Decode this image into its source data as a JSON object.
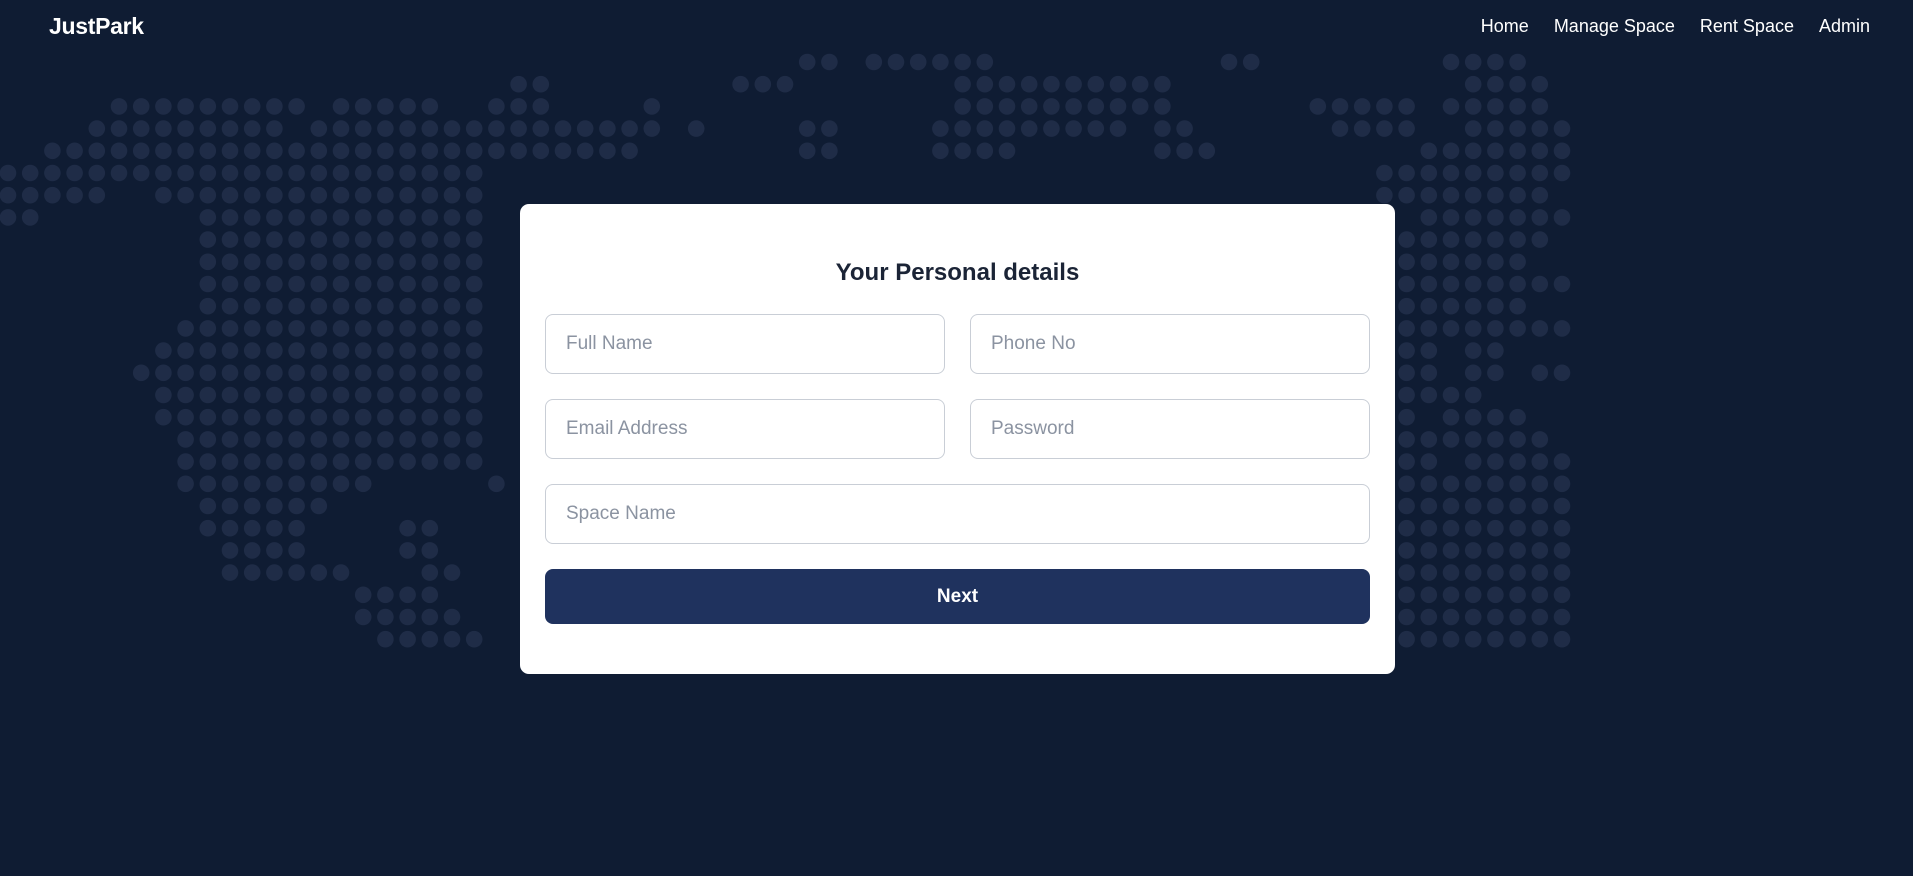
{
  "colors": {
    "page_background": "#0f1c33",
    "dot_color": "#1f2c47",
    "card_background": "#ffffff",
    "title_text": "#1b2436",
    "button_background": "#1f325e",
    "button_text": "#ffffff",
    "input_border": "#c9ced6",
    "placeholder_text": "#8b93a1"
  },
  "background": {
    "pattern": "dotted-world-map"
  },
  "navbar": {
    "brand": "JustPark",
    "links": [
      {
        "label": "Home"
      },
      {
        "label": "Manage Space"
      },
      {
        "label": "Rent Space"
      },
      {
        "label": "Admin"
      }
    ]
  },
  "form": {
    "title": "Your Personal details",
    "fields": {
      "full_name": {
        "placeholder": "Full Name",
        "value": ""
      },
      "phone": {
        "placeholder": "Phone No",
        "value": ""
      },
      "email": {
        "placeholder": "Email Address",
        "value": ""
      },
      "password": {
        "placeholder": "Password",
        "value": ""
      },
      "space_name": {
        "placeholder": "Space Name",
        "value": ""
      }
    },
    "submit_label": "Next"
  }
}
